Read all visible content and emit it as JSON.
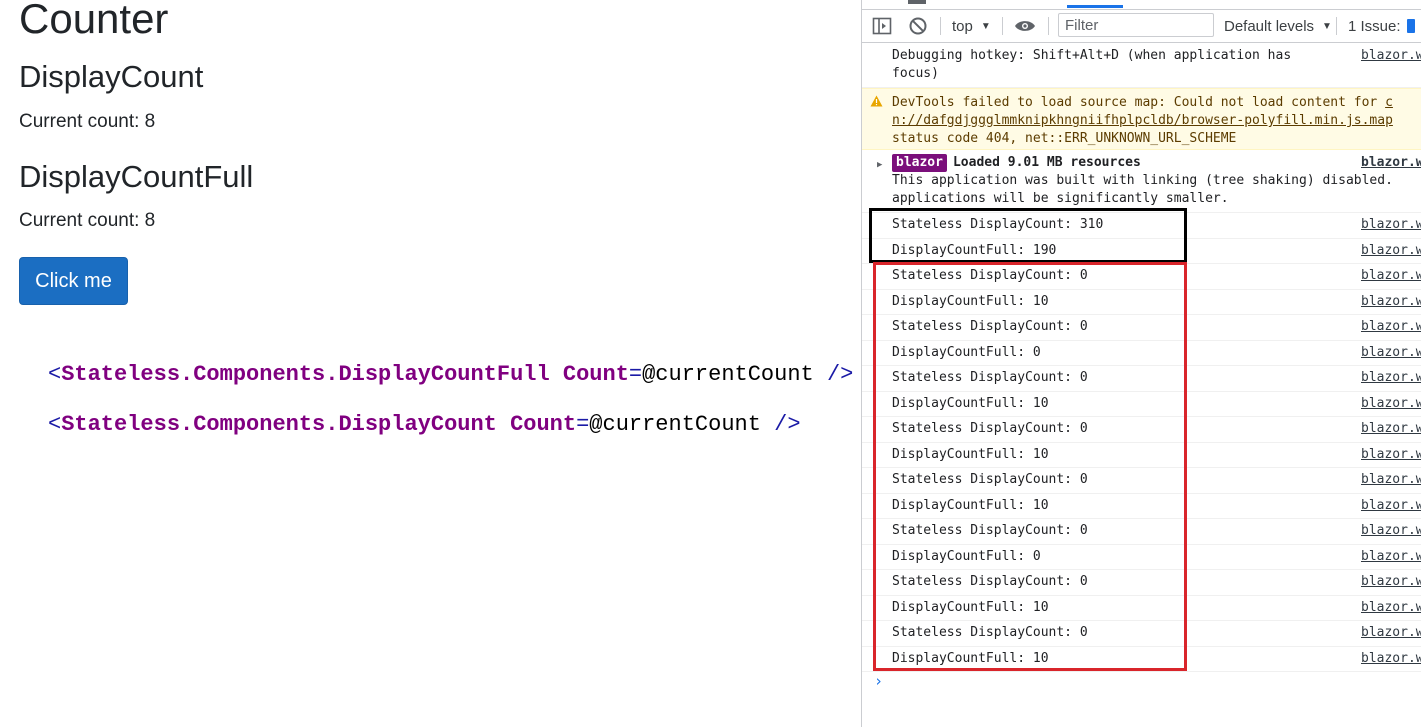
{
  "app": {
    "title": "Counter",
    "display_count": {
      "heading": "DisplayCount",
      "current": "Current count: 8"
    },
    "display_count_full": {
      "heading": "DisplayCountFull",
      "current": "Current count: 8"
    },
    "button_label": "Click me",
    "code_lines": [
      {
        "open": "<",
        "component": "Stateless.Components.DisplayCountFull",
        "attr": "Count",
        "eq": "=",
        "value": "@currentCount",
        "close": "/>"
      },
      {
        "open": "<",
        "component": "Stateless.Components.DisplayCount",
        "attr": "Count",
        "eq": "=",
        "value": "@currentCount",
        "close": "/>"
      }
    ]
  },
  "devtools": {
    "toolbar": {
      "context": "top",
      "filter_placeholder": "Filter",
      "levels": "Default levels",
      "issues": "1 Issue:"
    },
    "messages": {
      "debug": {
        "text": "Debugging hotkey: Shift+Alt+D (when application has\nfocus)",
        "source": "blazor.w"
      },
      "warning": {
        "line1": "DevTools failed to load source map: Could not load content for ",
        "link1": "c",
        "link2": "n://dafgdjggglmmknipkhngniifhplpcldb/browser-polyfill.min.js.map",
        "line3": "status code 404, net::ERR_UNKNOWN_URL_SCHEME"
      },
      "blazor": {
        "badge": "blazor",
        "headline": "Loaded 9.01 MB resources",
        "body": "This application was built with linking (tree shaking) disabled.\napplications will be significantly smaller.",
        "source": "blazor.w"
      },
      "logs": [
        {
          "text": "Stateless DisplayCount: 310",
          "source": "blazor.w"
        },
        {
          "text": "DisplayCountFull: 190",
          "source": "blazor.w"
        },
        {
          "text": "Stateless DisplayCount: 0",
          "source": "blazor.w"
        },
        {
          "text": "DisplayCountFull: 10",
          "source": "blazor.w"
        },
        {
          "text": "Stateless DisplayCount: 0",
          "source": "blazor.w"
        },
        {
          "text": "DisplayCountFull: 0",
          "source": "blazor.w"
        },
        {
          "text": "Stateless DisplayCount: 0",
          "source": "blazor.w"
        },
        {
          "text": "DisplayCountFull: 10",
          "source": "blazor.w"
        },
        {
          "text": "Stateless DisplayCount: 0",
          "source": "blazor.w"
        },
        {
          "text": "DisplayCountFull: 10",
          "source": "blazor.w"
        },
        {
          "text": "Stateless DisplayCount: 0",
          "source": "blazor.w"
        },
        {
          "text": "DisplayCountFull: 10",
          "source": "blazor.w"
        },
        {
          "text": "Stateless DisplayCount: 0",
          "source": "blazor.w"
        },
        {
          "text": "DisplayCountFull: 0",
          "source": "blazor.w"
        },
        {
          "text": "Stateless DisplayCount: 0",
          "source": "blazor.w"
        },
        {
          "text": "DisplayCountFull: 10",
          "source": "blazor.w"
        },
        {
          "text": "Stateless DisplayCount: 0",
          "source": "blazor.w"
        },
        {
          "text": "DisplayCountFull: 10",
          "source": "blazor.w"
        }
      ]
    },
    "prompt": "›"
  },
  "colors": {
    "button_bg": "#1b6ec2",
    "highlight_black": "#000000",
    "highlight_red": "#d9252b",
    "blazor_badge": "#7b0f7b",
    "warning_bg": "#fffbe5"
  },
  "icons": [
    "sidebar-toggle-icon",
    "clear-console-icon",
    "eye-icon",
    "warning-icon",
    "expand-triangle-icon",
    "prompt-chevron-icon"
  ]
}
